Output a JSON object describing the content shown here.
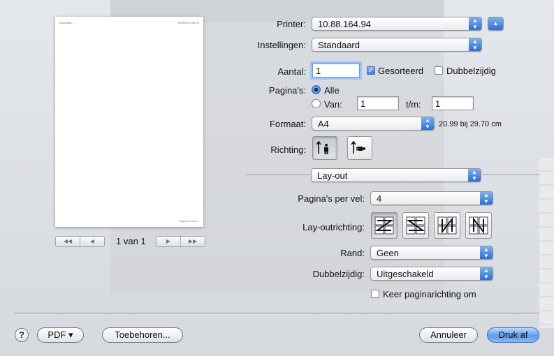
{
  "preview": {
    "page_header_left": "Apparaten",
    "page_header_right": "23/08/2010 08:29",
    "page_footer": "Pagina 1 van 1",
    "page_indicator": "1 van 1"
  },
  "printer": {
    "label": "Printer:",
    "value": "10.88.164.94"
  },
  "presets": {
    "label": "Instellingen:",
    "value": "Standaard"
  },
  "copies": {
    "label": "Aantal:",
    "value": "1",
    "collated_label": "Gesorteerd",
    "collated": true,
    "two_sided_label": "Dubbelzijdig",
    "two_sided": false
  },
  "pages": {
    "label": "Pagina's:",
    "all_label": "Alle",
    "from_label": "Van:",
    "from_value": "1",
    "to_label": "t/m:",
    "to_value": "1",
    "selected": "all"
  },
  "paper": {
    "label": "Formaat:",
    "value": "A4",
    "size_text": "20.99 bij 29.70 cm"
  },
  "orientation": {
    "label": "Richting:",
    "selected": "portrait"
  },
  "panel": {
    "value": "Lay-out"
  },
  "layout": {
    "pages_per_sheet_label": "Pagina's per vel:",
    "pages_per_sheet": "4",
    "direction_label": "Lay-outrichting:",
    "direction_selected": 0,
    "border_label": "Rand:",
    "border": "Geen",
    "two_sided_label": "Dubbelzijdig:",
    "two_sided": "Uitgeschakeld",
    "reverse_label": "Keer paginarichting om",
    "reverse": false
  },
  "footer": {
    "help": "?",
    "pdf": "PDF ▾",
    "supplies": "Toebehoren...",
    "cancel": "Annuleer",
    "print": "Druk af"
  },
  "colors": {
    "accent": "#3a7ad8",
    "default_button": "#5c9aea",
    "background": "#dcdfe3"
  }
}
